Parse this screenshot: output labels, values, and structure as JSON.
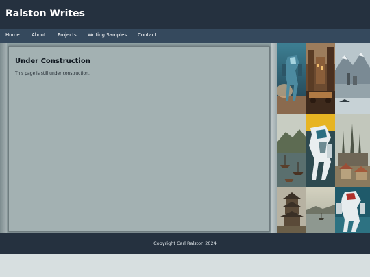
{
  "site": {
    "title": "Ralston Writes"
  },
  "nav": {
    "items": [
      {
        "label": "Home"
      },
      {
        "label": "About"
      },
      {
        "label": "Projects"
      },
      {
        "label": "Writing Samples"
      },
      {
        "label": "Contact"
      }
    ]
  },
  "main": {
    "heading": "Under Construction",
    "body": "This page is still under construction."
  },
  "gallery": {
    "images": [
      {
        "name": "robot-mech-image"
      },
      {
        "name": "steampunk-street-image"
      },
      {
        "name": "mountain-castle-image"
      },
      {
        "name": "harbor-boats-image"
      },
      {
        "name": "robot-mech-yellow-image"
      },
      {
        "name": "gothic-city-image"
      },
      {
        "name": "pagoda-tower-image"
      },
      {
        "name": "coastal-sea-image"
      },
      {
        "name": "robot-mech-small-image"
      }
    ]
  },
  "footer": {
    "copyright": "Copyright Carl Ralston 2024"
  },
  "colors": {
    "header_bg": "#25313f",
    "nav_bg": "#35495d",
    "card_bg": "#a3b1b2",
    "page_bg": "#d7dfe0"
  }
}
